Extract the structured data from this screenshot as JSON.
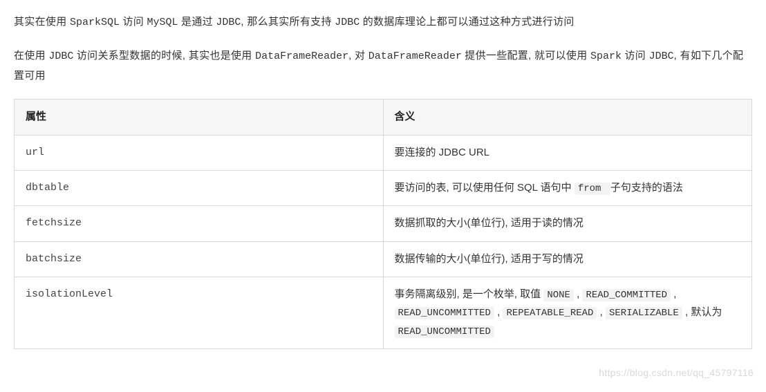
{
  "paragraphs": {
    "p1_parts": [
      "其实在使用 ",
      "SparkSQL",
      " 访问 ",
      "MySQL",
      " 是通过 ",
      "JDBC",
      ", 那么其实所有支持 ",
      "JDBC",
      " 的数据库理论上都可以通过这种方式进行访问"
    ],
    "p2_parts": [
      "在使用 ",
      "JDBC",
      " 访问关系型数据的时候, 其实也是使用 ",
      "DataFrameReader",
      ", 对 ",
      "DataFrameReader",
      " 提供一些配置, 就可以使用 ",
      "Spark",
      " 访问 ",
      "JDBC",
      ", 有如下几个配置可用"
    ]
  },
  "table": {
    "headers": {
      "col1": "属性",
      "col2": "含义"
    },
    "rows": [
      {
        "prop": "url",
        "desc_parts": [
          "要连接的 JDBC URL"
        ]
      },
      {
        "prop": "dbtable",
        "desc_parts": [
          "要访问的表, 可以使用任何 SQL 语句中 ",
          " from ",
          " 子句支持的语法"
        ]
      },
      {
        "prop": "fetchsize",
        "desc_parts": [
          "数据抓取的大小(单位行), 适用于读的情况"
        ]
      },
      {
        "prop": "batchsize",
        "desc_parts": [
          "数据传输的大小(单位行), 适用于写的情况"
        ]
      },
      {
        "prop": "isolationLevel",
        "desc_parts": [
          "事务隔离级别, 是一个枚举, 取值 ",
          "NONE",
          " , ",
          "READ_COMMITTED",
          " , ",
          "READ_UNCOMMITTED",
          " , ",
          "REPEATABLE_READ",
          " , ",
          "SERIALIZABLE",
          " , 默认为 ",
          "READ_UNCOMMITTED"
        ]
      }
    ]
  },
  "watermark": "https://blog.csdn.net/qq_45797116"
}
